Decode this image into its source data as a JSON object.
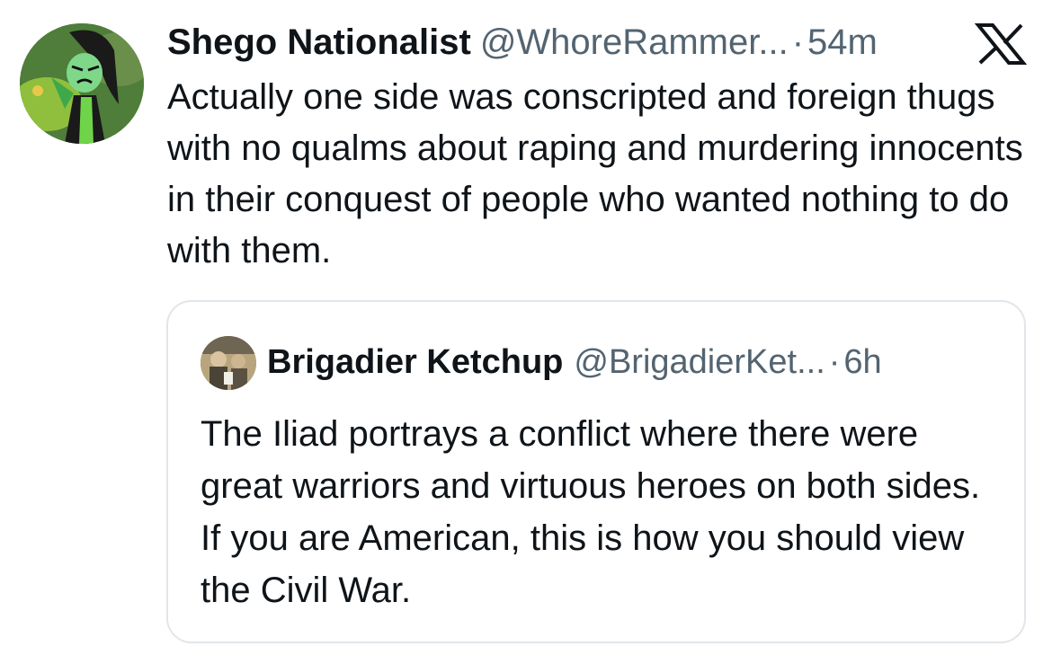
{
  "tweet": {
    "author": {
      "display_name": "Shego Nationalist",
      "handle": "@WhoreRammer...",
      "avatar": "avatar-cartoon-shego"
    },
    "separator": "·",
    "time": "54m",
    "platform_icon": "x-logo-icon",
    "text": "Actually one side was conscripted and foreign thugs with no qualms about raping and murdering innocents in their conquest of people who wanted nothing to do with them.",
    "quoted_tweet": {
      "author": {
        "display_name": "Brigadier Ketchup",
        "handle": "@BrigadierKet...",
        "avatar": "avatar-photo"
      },
      "separator": "·",
      "time": "6h",
      "text": "The Iliad portrays a conflict where there were great warriors and virtuous heroes on both sides. If you are American, this is how you should view the Civil War."
    }
  },
  "colors": {
    "text_primary": "#0f1419",
    "text_secondary": "#536471",
    "border": "#e1e6ea",
    "background": "#ffffff"
  }
}
